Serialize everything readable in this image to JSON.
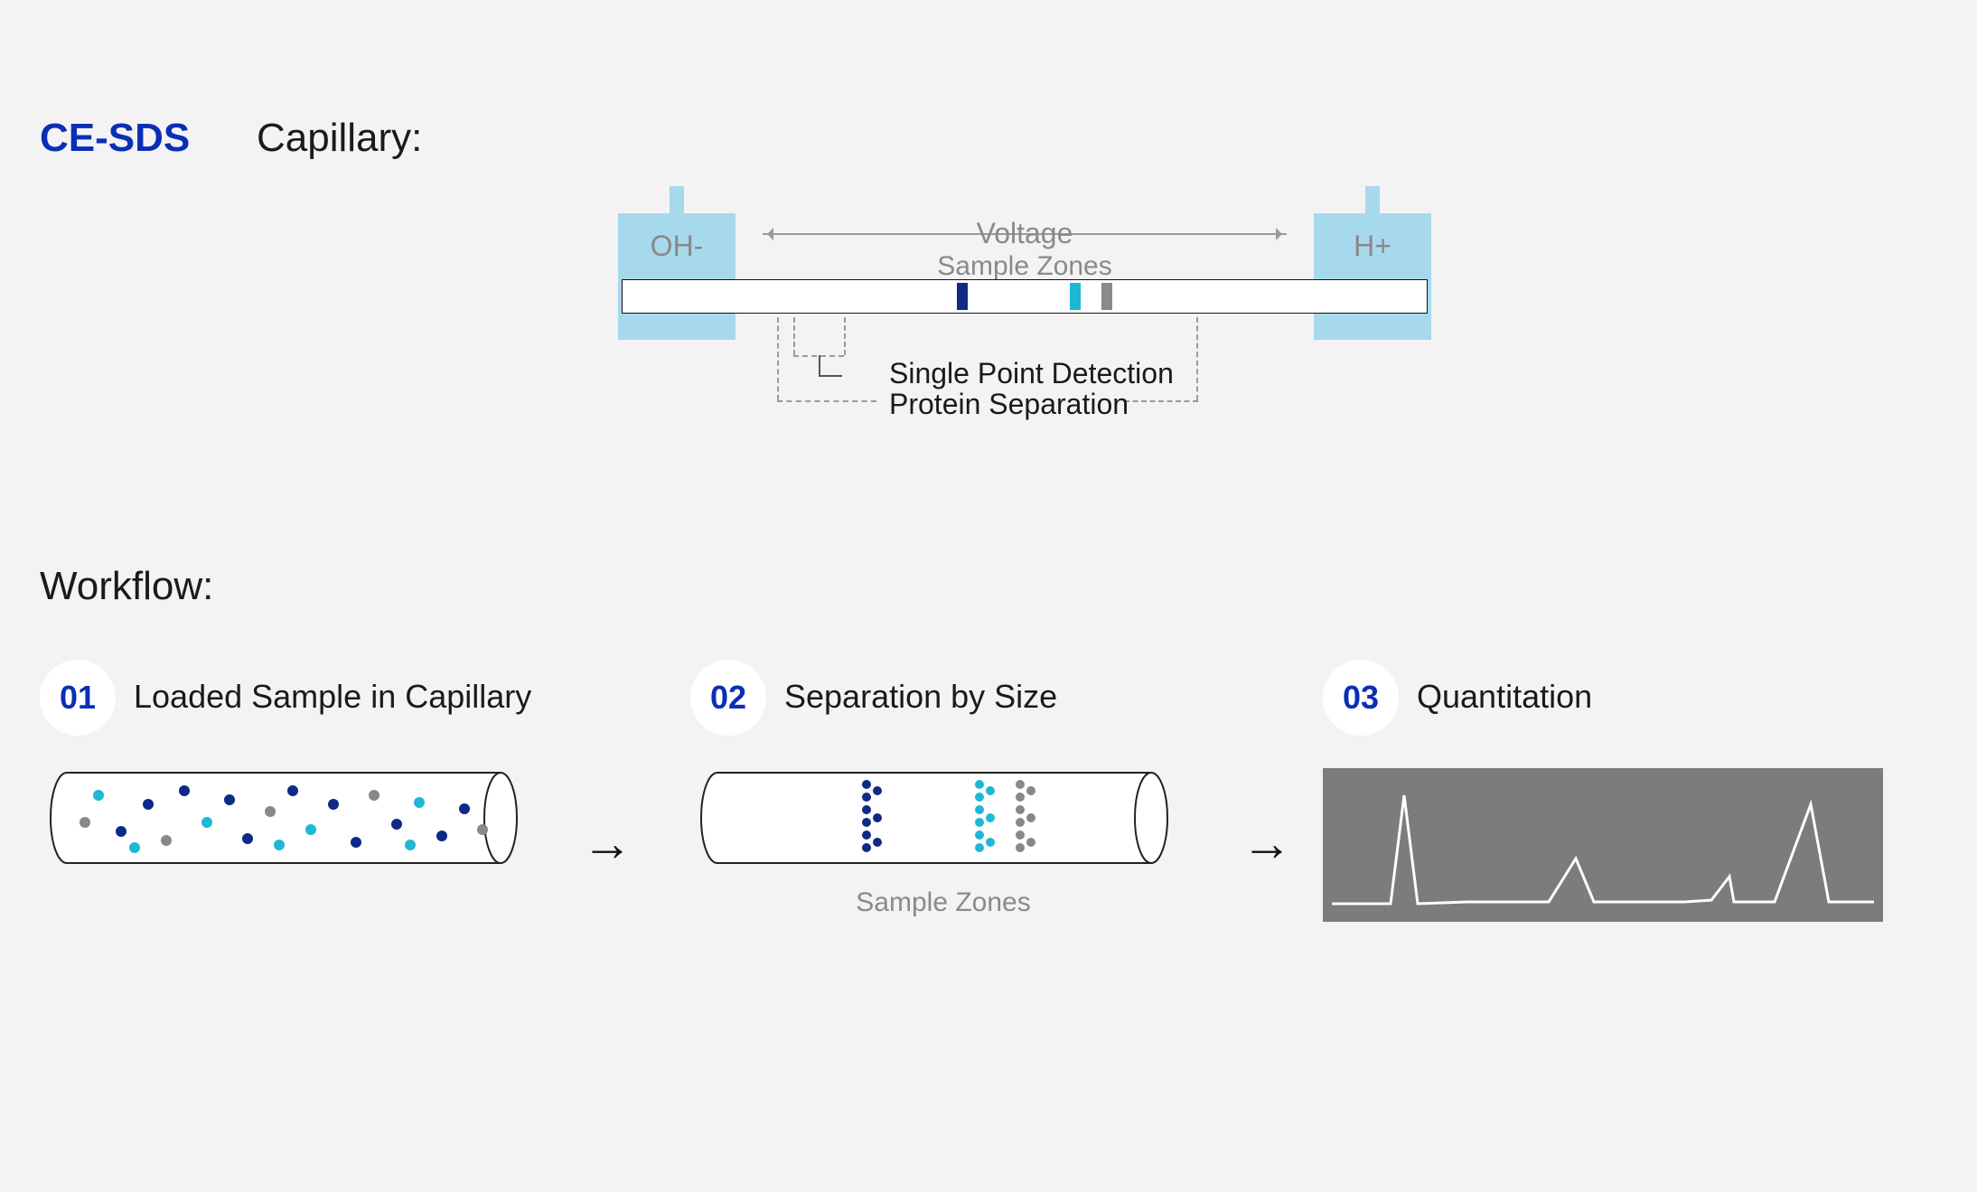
{
  "title": "CE-SDS",
  "capillary_label": "Capillary:",
  "diagram": {
    "left_ion": "OH-",
    "right_ion": "H+",
    "voltage_label": "Voltage",
    "sample_zones_label": "Sample Zones",
    "single_point_detection_label": "Single Point Detection",
    "protein_separation_label": "Protein Separation",
    "bands": [
      "navy",
      "cyan",
      "gray"
    ]
  },
  "workflow_label": "Workflow:",
  "steps": [
    {
      "num": "01",
      "title": "Loaded Sample in Capillary"
    },
    {
      "num": "02",
      "title": "Separation by Size",
      "caption": "Sample Zones"
    },
    {
      "num": "03",
      "title": "Quantitation"
    }
  ],
  "colors": {
    "navy": "#0e2a86",
    "cyan": "#1fb7d6",
    "gray": "#8a8a8a",
    "reservoir": "#a7d9ed",
    "accent": "#0a2fb5"
  }
}
